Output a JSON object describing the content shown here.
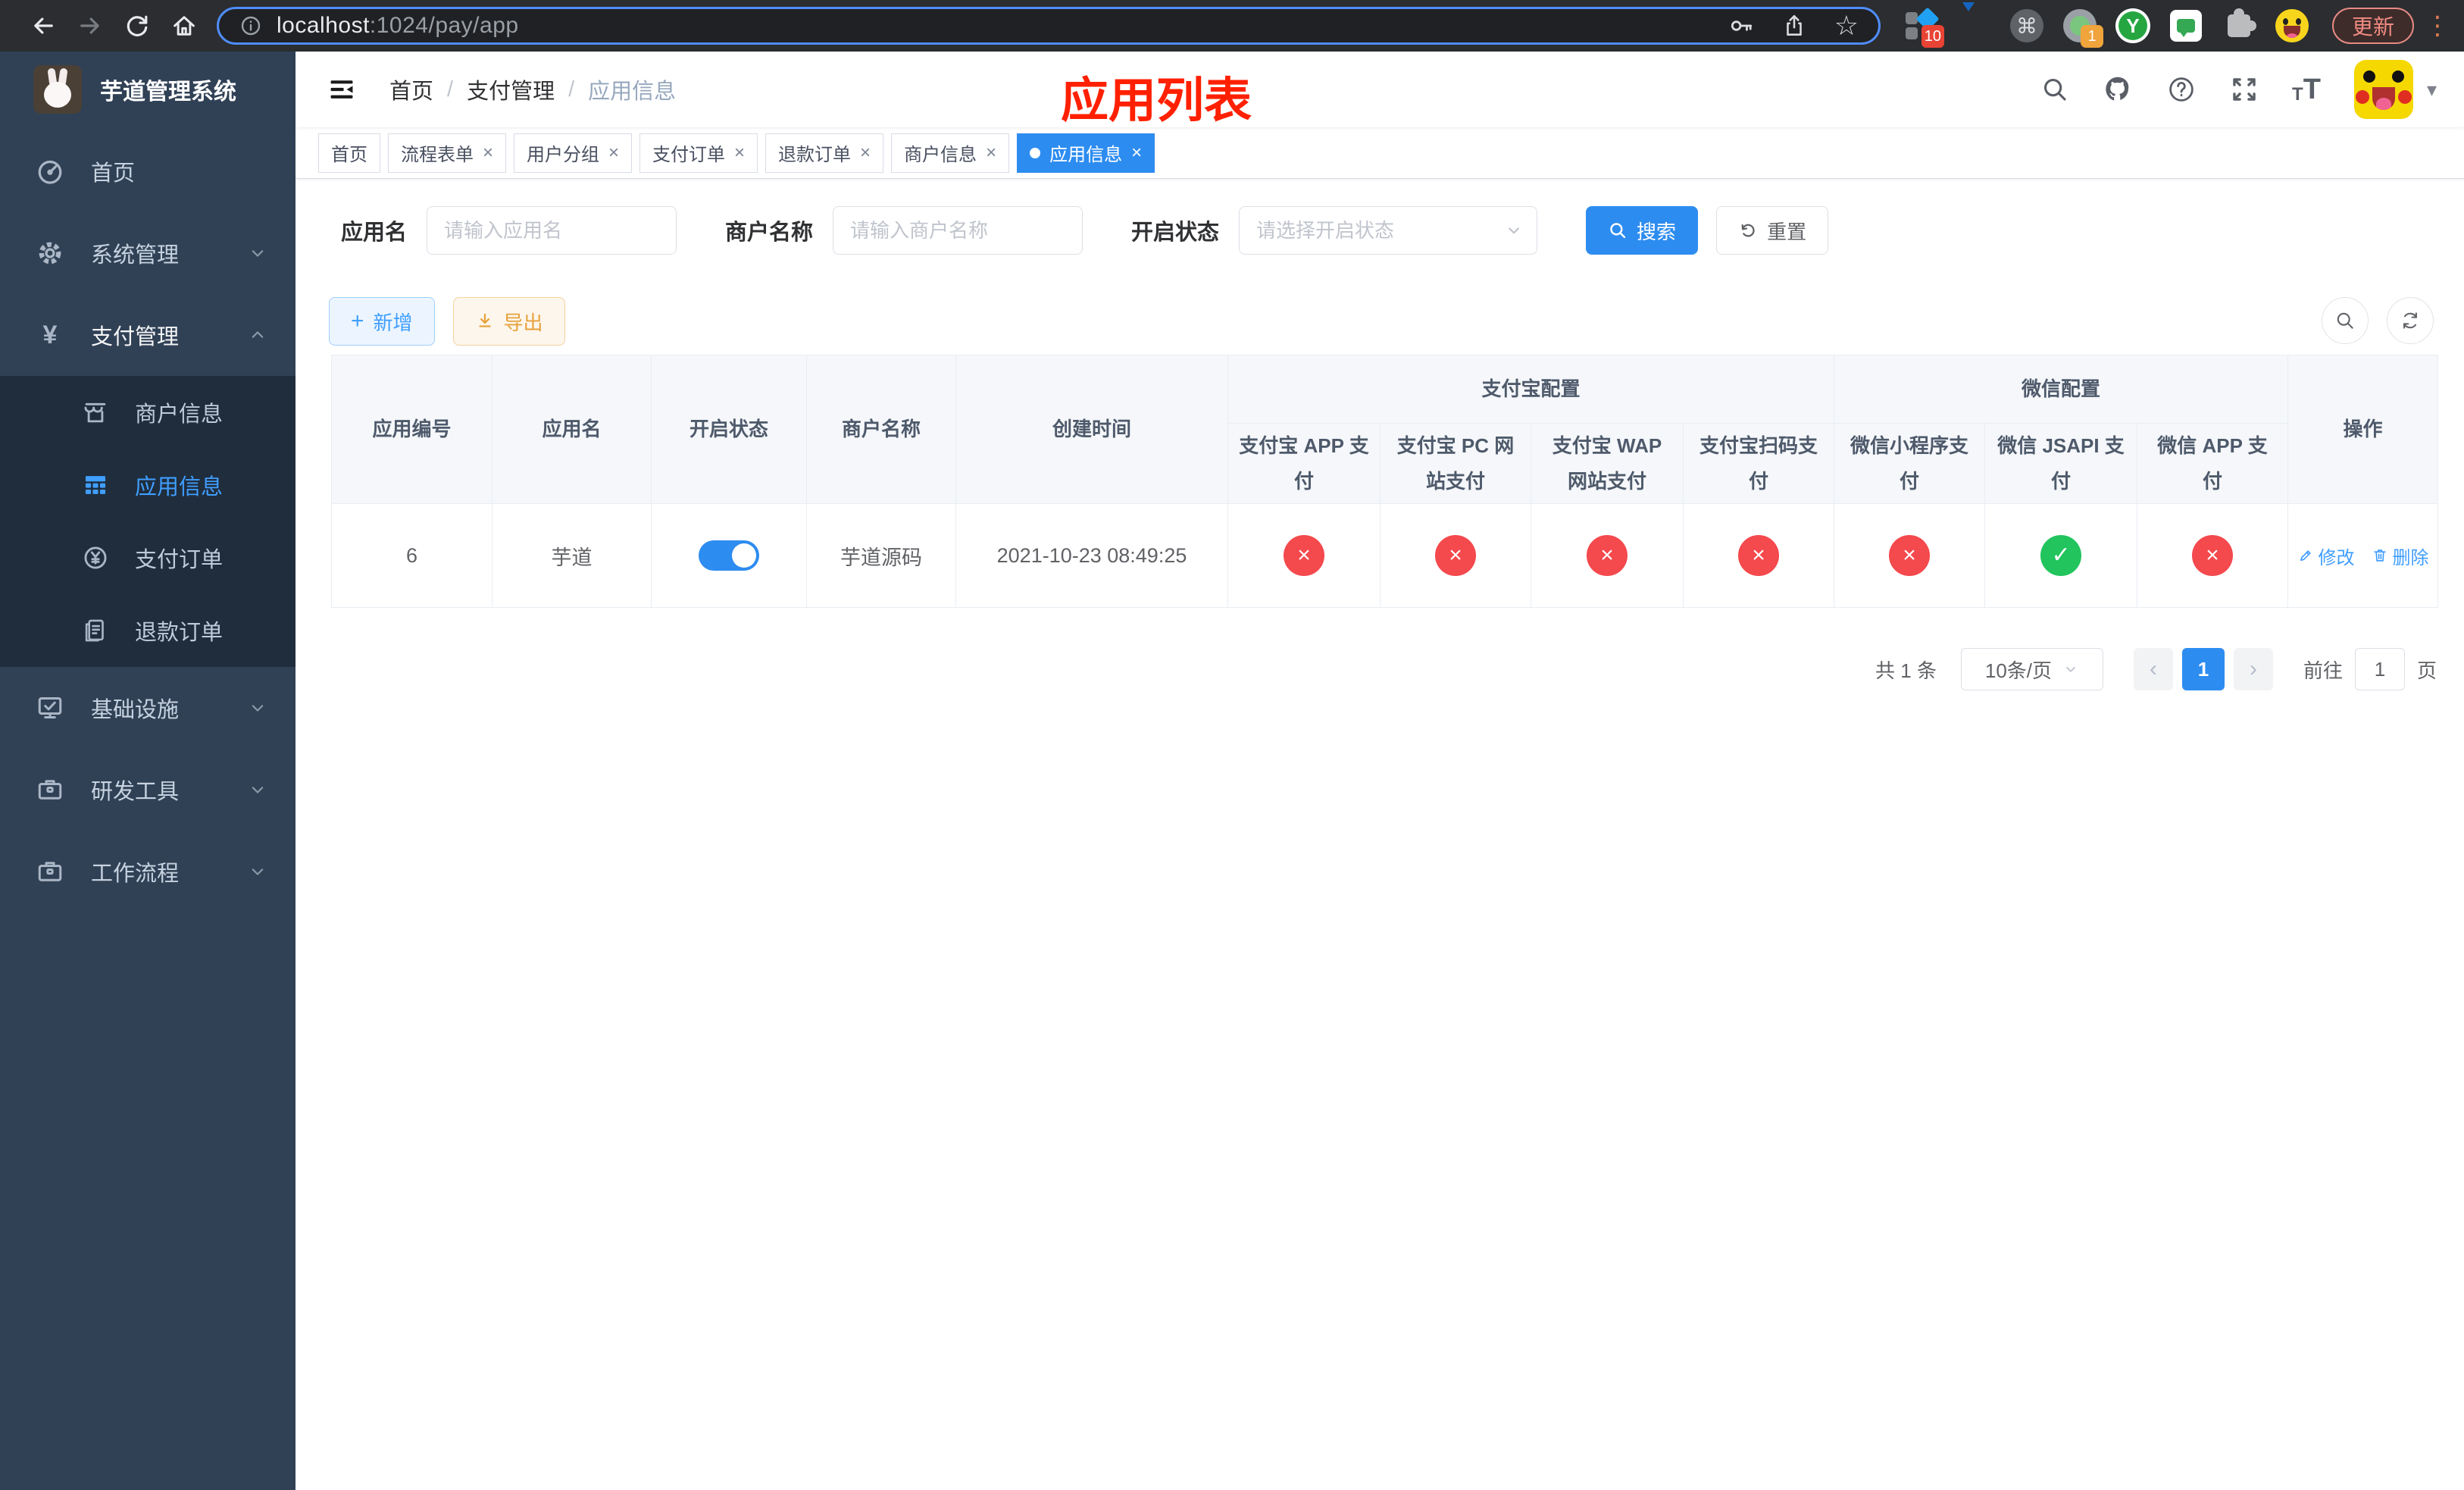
{
  "browser": {
    "url": {
      "host": "localhost",
      "rest": ":1024/pay/app"
    },
    "extensions": {
      "badge_blocks": "10",
      "badge_green": "1",
      "y_label": "Y"
    },
    "update_button": "更新"
  },
  "icons": {
    "star": "☆",
    "command": "⌘",
    "kebab": "⋮",
    "caret": "▾",
    "yen": "¥",
    "plus": "+",
    "close": "×",
    "font_small": "T",
    "font_large": "T"
  },
  "sidebar": {
    "title": "芋道管理系统",
    "menu": {
      "home": "首页",
      "system": "系统管理",
      "payment": "支付管理",
      "merchant_info": "商户信息",
      "app_info": "应用信息",
      "pay_order": "支付订单",
      "refund_order": "退款订单",
      "infrastructure": "基础设施",
      "dev_tools": "研发工具",
      "workflow": "工作流程"
    }
  },
  "header": {
    "breadcrumb": [
      "首页",
      "支付管理",
      "应用信息"
    ],
    "separator": "/",
    "overlay_title": "应用列表"
  },
  "tabs": [
    {
      "label": "首页",
      "closable": false,
      "active": false
    },
    {
      "label": "流程表单",
      "closable": true,
      "active": false
    },
    {
      "label": "用户分组",
      "closable": true,
      "active": false
    },
    {
      "label": "支付订单",
      "closable": true,
      "active": false
    },
    {
      "label": "退款订单",
      "closable": true,
      "active": false
    },
    {
      "label": "商户信息",
      "closable": true,
      "active": false
    },
    {
      "label": "应用信息",
      "closable": true,
      "active": true
    }
  ],
  "filters": {
    "app_name": {
      "label": "应用名",
      "placeholder": "请输入应用名",
      "value": ""
    },
    "merchant_name": {
      "label": "商户名称",
      "placeholder": "请输入商户名称",
      "value": ""
    },
    "status": {
      "label": "开启状态",
      "placeholder": "请选择开启状态",
      "value": ""
    },
    "search_button": "搜索",
    "reset_button": "重置"
  },
  "toolbar": {
    "add_button": "新增",
    "export_button": "导出"
  },
  "table": {
    "columns": {
      "app_id": "应用编号",
      "app_name": "应用名",
      "status": "开启状态",
      "merchant": "商户名称",
      "created_at": "创建时间",
      "alipay_group": "支付宝配置",
      "alipay_cols": [
        "支付宝 APP 支付",
        "支付宝 PC 网站支付",
        "支付宝 WAP 网站支付",
        "支付宝扫码支付"
      ],
      "wechat_group": "微信配置",
      "wechat_cols": [
        "微信小程序支付",
        "微信 JSAPI 支付",
        "微信 APP 支付"
      ],
      "actions": "操作"
    },
    "status_icons": {
      "true": "✓",
      "false": "×"
    },
    "rows": [
      {
        "app_id": "6",
        "app_name": "芋道",
        "enabled": true,
        "merchant": "芋道源码",
        "created_at": "2021-10-23 08:49:25",
        "pay_statuses": [
          false,
          false,
          false,
          false,
          false,
          true,
          false
        ],
        "edit": "修改",
        "delete": "删除"
      }
    ]
  },
  "pagination": {
    "total": "共 1 条",
    "page_size": "10条/页",
    "prev": "‹",
    "page": "1",
    "next": "›",
    "goto_label": "前往",
    "goto_value": "1",
    "goto_unit": "页"
  },
  "colors": {
    "primary": "#2d8cf0",
    "link": "#409eff",
    "danger": "#f4494d",
    "success": "#21c45d",
    "warning": "#e6a23c",
    "overlay_title": "#ff2000",
    "sidebar_bg": "#304156",
    "submenu_bg": "#1f2d3d"
  }
}
